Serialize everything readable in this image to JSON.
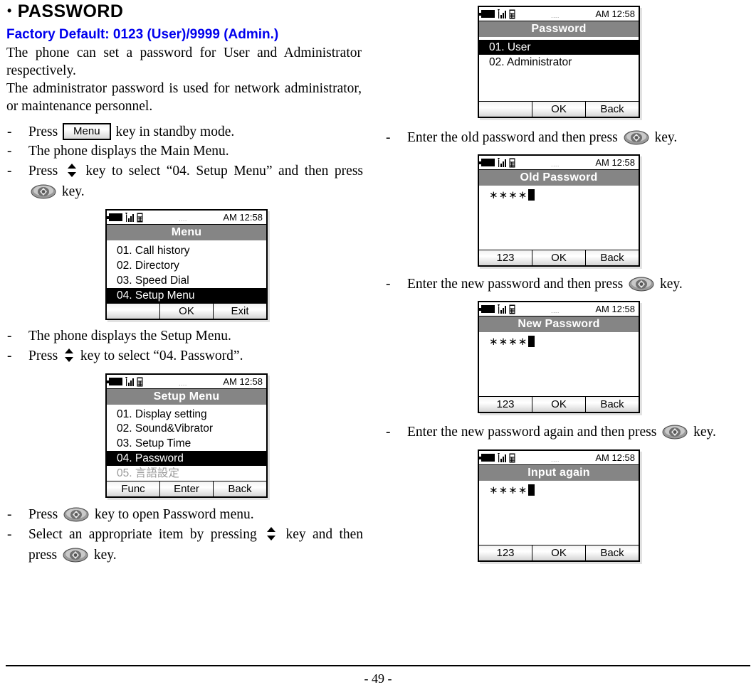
{
  "heading": {
    "bullet": "•",
    "title": "PASSWORD"
  },
  "factory_default": "Factory Default: 0123 (User)/9999 (Admin.)",
  "factory_default_color": "#0000ee",
  "intro": {
    "paragraph_1": "The phone can set a password for User and Administrator respectively.",
    "paragraph_2": "The administrator password is used for network administrator, or maintenance personnel."
  },
  "steps": {
    "s1_pre": "Press",
    "s1_key": "Menu",
    "s1_post": "key in standby mode.",
    "s2": "The phone displays the Main Menu.",
    "s3_pre": "Press",
    "s3_mid": "key to select “04. Setup Menu” and then press",
    "s3_post": "key.",
    "s4": "The phone displays the Setup Menu.",
    "s5_pre": "Press",
    "s5_post": "key to select “04. Password”.",
    "s6_pre": "Press",
    "s6_post": "key to open Password menu.",
    "s7_pre": "Select an appropriate item by pressing",
    "s7_mid": "key and then press",
    "s7_post": "key.",
    "s8_pre": "Enter the old password and then press",
    "s8_post": "key.",
    "s9_pre": "Enter the new password and then press",
    "s9_post": "key.",
    "s10_pre": "Enter the new password again and then press",
    "s10_post": "key."
  },
  "screens": {
    "status": {
      "time": "AM 12:58",
      "dots": "....",
      "icons": [
        "battery-icon",
        "signal-icon",
        "handset-icon"
      ]
    },
    "menu": {
      "title": "Menu",
      "items": [
        {
          "label": "01. Call history",
          "selected": false
        },
        {
          "label": "02. Directory",
          "selected": false
        },
        {
          "label": "03. Speed Dial",
          "selected": false
        },
        {
          "label": "04. Setup Menu",
          "selected": true
        }
      ],
      "softkeys": [
        "",
        "OK",
        "Exit"
      ]
    },
    "setup_menu": {
      "title": "Setup Menu",
      "items": [
        {
          "label": "01. Display setting",
          "selected": false,
          "dim": false
        },
        {
          "label": "02. Sound&Vibrator",
          "selected": false,
          "dim": false
        },
        {
          "label": "03. Setup Time",
          "selected": false,
          "dim": false
        },
        {
          "label": "04. Password",
          "selected": true,
          "dim": false
        },
        {
          "label": "05. 言語設定",
          "selected": false,
          "dim": true
        }
      ],
      "softkeys": [
        "Func",
        "Enter",
        "Back"
      ]
    },
    "password": {
      "title": "Password",
      "items": [
        {
          "label": "01. User",
          "selected": true
        },
        {
          "label": "02. Administrator",
          "selected": false
        }
      ],
      "softkeys": [
        "",
        "OK",
        "Back"
      ]
    },
    "old_password": {
      "title": "Old Password",
      "value": "∗∗∗∗",
      "softkeys": [
        "123",
        "OK",
        "Back"
      ]
    },
    "new_password": {
      "title": "New Password",
      "value": "∗∗∗∗",
      "softkeys": [
        "123",
        "OK",
        "Back"
      ]
    },
    "input_again": {
      "title": "Input again",
      "value": "∗∗∗∗",
      "softkeys": [
        "123",
        "OK",
        "Back"
      ]
    }
  },
  "footer": {
    "page": "- 49 -"
  }
}
